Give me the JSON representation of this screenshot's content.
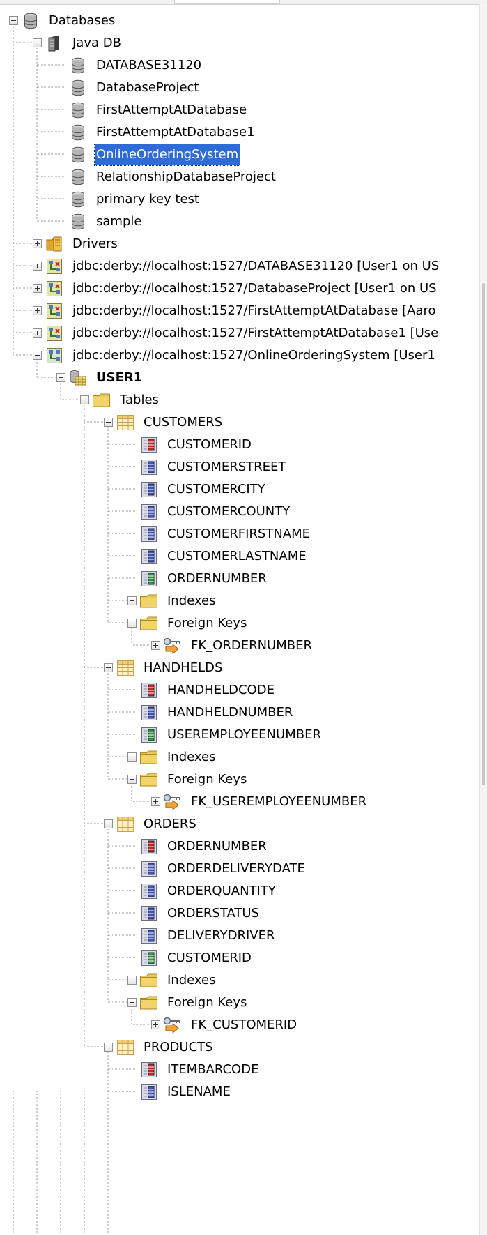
{
  "colors": {
    "selection": "#2f6bd6",
    "folder": "#f2d46b",
    "tree_line": "#9b9b9b",
    "pk_column": "#cc2222",
    "column": "#3f55c4",
    "fk_column": "#2a9a3c"
  },
  "tree": [
    {
      "label": "Databases",
      "level": 0,
      "toggle": "minus",
      "icon": "database-icon"
    },
    {
      "label": "Java DB",
      "level": 1,
      "toggle": "minus",
      "icon": "server-icon"
    },
    {
      "label": "DATABASE31120",
      "level": 2,
      "toggle": "none",
      "icon": "database-icon"
    },
    {
      "label": "DatabaseProject",
      "level": 2,
      "toggle": "none",
      "icon": "database-icon"
    },
    {
      "label": "FirstAttemptAtDatabase",
      "level": 2,
      "toggle": "none",
      "icon": "database-icon"
    },
    {
      "label": "FirstAttemptAtDatabase1",
      "level": 2,
      "toggle": "none",
      "icon": "database-icon"
    },
    {
      "label": "OnlineOrderingSystem",
      "level": 2,
      "toggle": "none",
      "icon": "database-icon",
      "selected": true
    },
    {
      "label": "RelationshipDatabaseProject",
      "level": 2,
      "toggle": "none",
      "icon": "database-icon"
    },
    {
      "label": "primary key test",
      "level": 2,
      "toggle": "none",
      "icon": "database-icon"
    },
    {
      "label": "sample",
      "level": 2,
      "toggle": "none",
      "icon": "database-icon"
    },
    {
      "label": "Drivers",
      "level": 1,
      "toggle": "plus",
      "icon": "drivers-folder-icon"
    },
    {
      "label": "jdbc:derby://localhost:1527/DATABASE31120 [User1 on US",
      "level": 1,
      "toggle": "plus",
      "icon": "connection-broken-icon"
    },
    {
      "label": "jdbc:derby://localhost:1527/DatabaseProject [User1 on US",
      "level": 1,
      "toggle": "plus",
      "icon": "connection-broken-icon"
    },
    {
      "label": "jdbc:derby://localhost:1527/FirstAttemptAtDatabase [Aaro",
      "level": 1,
      "toggle": "plus",
      "icon": "connection-broken-icon"
    },
    {
      "label": "jdbc:derby://localhost:1527/FirstAttemptAtDatabase1 [Use",
      "level": 1,
      "toggle": "plus",
      "icon": "connection-broken-icon"
    },
    {
      "label": "jdbc:derby://localhost:1527/OnlineOrderingSystem [User1",
      "level": 1,
      "toggle": "minus",
      "icon": "connection-icon"
    },
    {
      "label": "USER1",
      "level": 2,
      "toggle": "minus",
      "icon": "schema-icon",
      "bold": true
    },
    {
      "label": "Tables",
      "level": 3,
      "toggle": "minus",
      "icon": "folder-icon"
    },
    {
      "label": "CUSTOMERS",
      "level": 4,
      "toggle": "minus",
      "icon": "table-icon"
    },
    {
      "label": "CUSTOMERID",
      "level": 5,
      "toggle": "none",
      "icon": "pk-column-icon"
    },
    {
      "label": "CUSTOMERSTREET",
      "level": 5,
      "toggle": "none",
      "icon": "column-icon"
    },
    {
      "label": "CUSTOMERCITY",
      "level": 5,
      "toggle": "none",
      "icon": "column-icon"
    },
    {
      "label": "CUSTOMERCOUNTY",
      "level": 5,
      "toggle": "none",
      "icon": "column-icon"
    },
    {
      "label": "CUSTOMERFIRSTNAME",
      "level": 5,
      "toggle": "none",
      "icon": "column-icon"
    },
    {
      "label": "CUSTOMERLASTNAME",
      "level": 5,
      "toggle": "none",
      "icon": "column-icon"
    },
    {
      "label": "ORDERNUMBER",
      "level": 5,
      "toggle": "none",
      "icon": "fk-column-icon"
    },
    {
      "label": "Indexes",
      "level": 5,
      "toggle": "plus",
      "icon": "folder-icon"
    },
    {
      "label": "Foreign Keys",
      "level": 5,
      "toggle": "minus",
      "icon": "folder-icon"
    },
    {
      "label": "FK_ORDERNUMBER",
      "level": 6,
      "toggle": "plus",
      "icon": "foreign-key-icon"
    },
    {
      "label": "HANDHELDS",
      "level": 4,
      "toggle": "minus",
      "icon": "table-icon"
    },
    {
      "label": "HANDHELDCODE",
      "level": 5,
      "toggle": "none",
      "icon": "pk-column-icon"
    },
    {
      "label": "HANDHELDNUMBER",
      "level": 5,
      "toggle": "none",
      "icon": "column-icon"
    },
    {
      "label": "USEREMPLOYEENUMBER",
      "level": 5,
      "toggle": "none",
      "icon": "fk-column-icon"
    },
    {
      "label": "Indexes",
      "level": 5,
      "toggle": "plus",
      "icon": "folder-icon"
    },
    {
      "label": "Foreign Keys",
      "level": 5,
      "toggle": "minus",
      "icon": "folder-icon"
    },
    {
      "label": "FK_USEREMPLOYEENUMBER",
      "level": 6,
      "toggle": "plus",
      "icon": "foreign-key-icon"
    },
    {
      "label": "ORDERS",
      "level": 4,
      "toggle": "minus",
      "icon": "table-icon"
    },
    {
      "label": "ORDERNUMBER",
      "level": 5,
      "toggle": "none",
      "icon": "pk-column-icon"
    },
    {
      "label": "ORDERDELIVERYDATE",
      "level": 5,
      "toggle": "none",
      "icon": "column-icon"
    },
    {
      "label": "ORDERQUANTITY",
      "level": 5,
      "toggle": "none",
      "icon": "column-icon"
    },
    {
      "label": "ORDERSTATUS",
      "level": 5,
      "toggle": "none",
      "icon": "column-icon"
    },
    {
      "label": "DELIVERYDRIVER",
      "level": 5,
      "toggle": "none",
      "icon": "column-icon"
    },
    {
      "label": "CUSTOMERID",
      "level": 5,
      "toggle": "none",
      "icon": "fk-column-icon"
    },
    {
      "label": "Indexes",
      "level": 5,
      "toggle": "plus",
      "icon": "folder-icon"
    },
    {
      "label": "Foreign Keys",
      "level": 5,
      "toggle": "minus",
      "icon": "folder-icon"
    },
    {
      "label": "FK_CUSTOMERID",
      "level": 6,
      "toggle": "plus",
      "icon": "foreign-key-icon"
    },
    {
      "label": "PRODUCTS",
      "level": 4,
      "toggle": "minus",
      "icon": "table-icon"
    },
    {
      "label": "ITEMBARCODE",
      "level": 5,
      "toggle": "none",
      "icon": "pk-column-icon"
    },
    {
      "label": "ISLENAME",
      "level": 5,
      "toggle": "none",
      "icon": "column-icon"
    }
  ]
}
